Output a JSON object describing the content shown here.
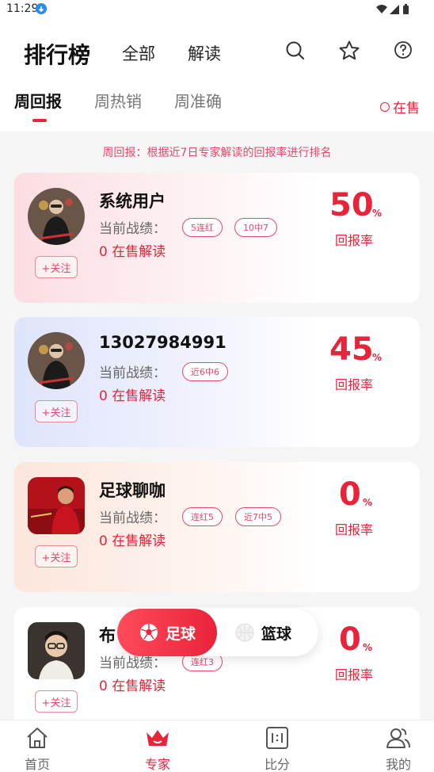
{
  "status_bar": {
    "time": "11:29"
  },
  "header": {
    "title": "排行榜",
    "tabs": [
      {
        "label": "全部"
      },
      {
        "label": "解读"
      }
    ],
    "icons": [
      "search-icon",
      "star-icon",
      "help-icon"
    ]
  },
  "subtabs": {
    "items": [
      {
        "label": "周回报"
      },
      {
        "label": "周热销"
      },
      {
        "label": "周准确"
      }
    ],
    "active_index": 0,
    "on_sale_label": "在售"
  },
  "notice": "周回报：根据近7日专家解读的回报率进行排名",
  "common": {
    "record_label": "当前战绩：",
    "follow_label": "+关注",
    "rate_label": "回报率",
    "pct": "%"
  },
  "experts": [
    {
      "name": "系统用户",
      "badges": [
        "5连红",
        "10中7"
      ],
      "on_sale": "0 在售解读",
      "rate": "50"
    },
    {
      "name": "13027984991",
      "badges": [
        "近6中6"
      ],
      "on_sale": "0 在售解读",
      "rate": "45"
    },
    {
      "name": "足球聊咖",
      "badges": [
        "连红5",
        "近7中5"
      ],
      "on_sale": "0 在售解读",
      "rate": "0"
    },
    {
      "name": "布",
      "badges": [
        "连红3"
      ],
      "on_sale": "0 在售解读",
      "rate": "0"
    }
  ],
  "sport_toggle": {
    "active": "足球",
    "inactive": "篮球"
  },
  "bottom_nav": [
    {
      "label": "首页",
      "icon": "home-icon"
    },
    {
      "label": "专家",
      "icon": "crown-icon",
      "active": true
    },
    {
      "label": "比分",
      "icon": "scoreboard-icon"
    },
    {
      "label": "我的",
      "icon": "user-icon"
    }
  ],
  "colors": {
    "accent": "#e8233a",
    "pink": "#e8476a"
  }
}
